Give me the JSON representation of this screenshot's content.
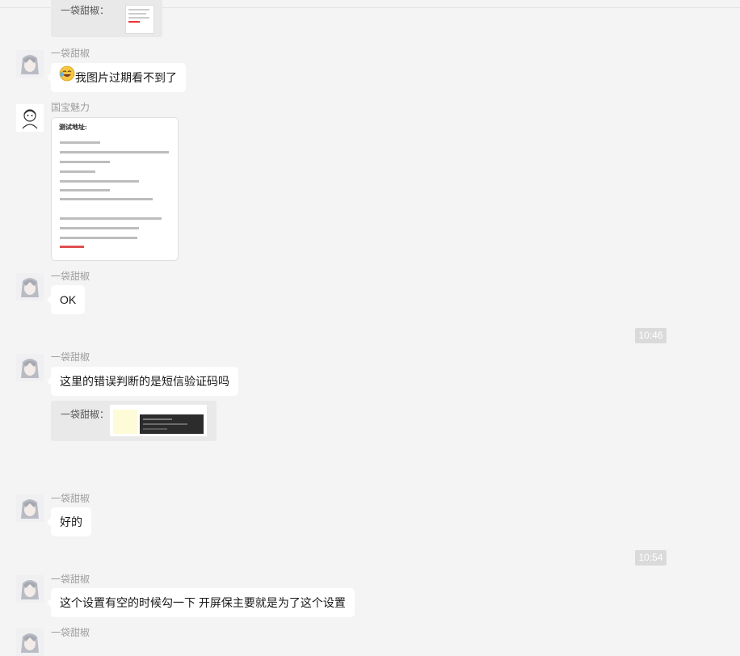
{
  "messages": [
    {
      "sender": "一袋甜椒",
      "text": "我图片过期看不到了"
    },
    {
      "sender": "国宝魅力",
      "document": {
        "title": "测试地址:"
      }
    },
    {
      "sender": "一袋甜椒",
      "text": "OK"
    },
    {
      "sender": "一袋甜椒",
      "text": "这里的错误判断的是短信验证码吗",
      "quote_label": "一袋甜椒："
    },
    {
      "sender": "一袋甜椒",
      "text": "好的"
    },
    {
      "sender": "一袋甜椒",
      "text": "这个设置有空的时候勾一下 开屏保主要就是为了这个设置"
    },
    {
      "sender": "一袋甜椒"
    }
  ],
  "timestamps": [
    "10:46",
    "10:54"
  ],
  "top_quote_label": "一袋甜椒：",
  "icons": {
    "emoji": "crying-laughing-emoji-icon"
  }
}
